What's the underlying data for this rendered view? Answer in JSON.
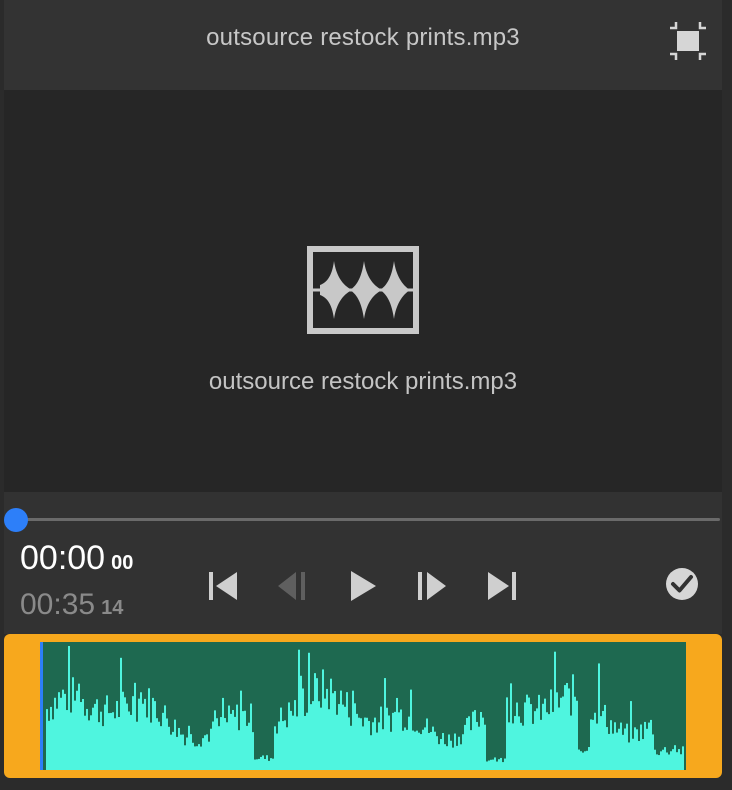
{
  "header": {
    "title": "outsource restock prints.mp3",
    "fit_icon": "fit-to-frame-icon"
  },
  "preview": {
    "icon": "audio-file-icon",
    "filename": "outsource restock prints.mp3"
  },
  "scrubber": {
    "progress": 0
  },
  "timecode": {
    "current_main": "00:00",
    "current_frames": "00",
    "duration_main": "00:35",
    "duration_frames": "14"
  },
  "transport": {
    "buttons": [
      {
        "name": "go-to-start-icon",
        "enabled": true
      },
      {
        "name": "step-back-icon",
        "enabled": false
      },
      {
        "name": "play-icon",
        "enabled": true
      },
      {
        "name": "step-forward-icon",
        "enabled": true
      },
      {
        "name": "go-to-end-icon",
        "enabled": true
      }
    ],
    "confirm_icon": "checkmark-circle-icon"
  },
  "colors": {
    "accent_blue": "#2d7ff9",
    "clip_border": "#f7a81d",
    "waveform_bg": "#1e6950",
    "waveform_fill": "#4ff5df"
  }
}
